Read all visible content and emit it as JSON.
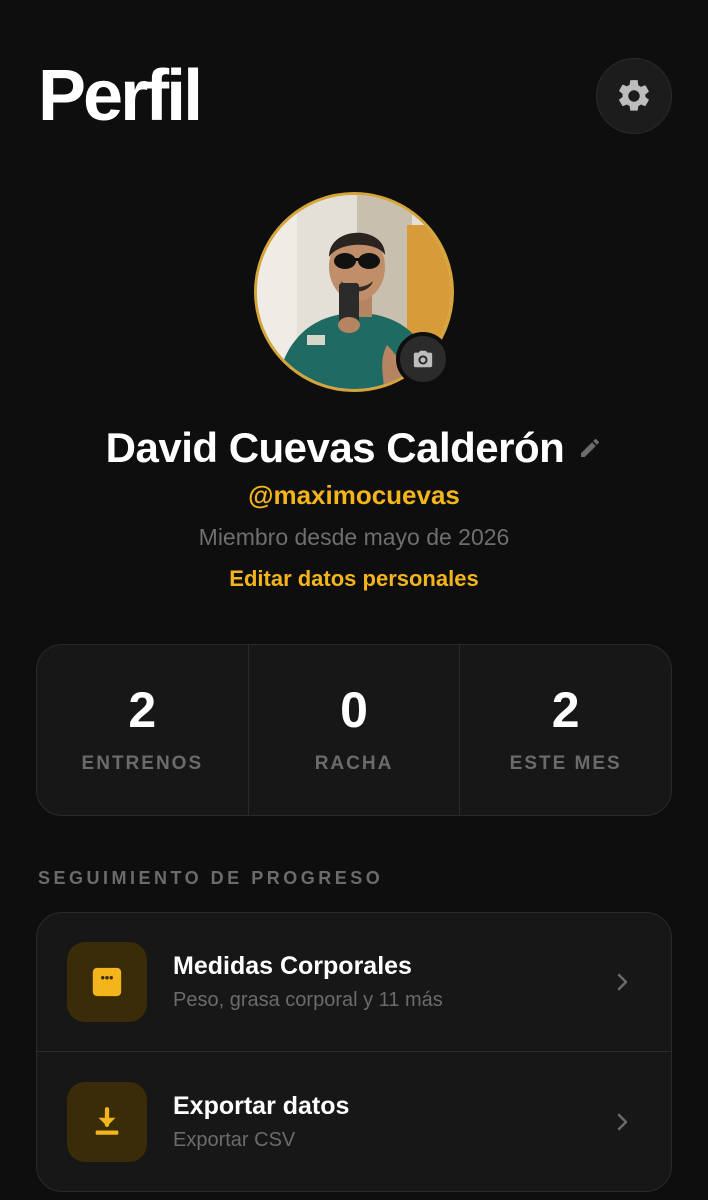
{
  "header": {
    "title": "Perfil"
  },
  "profile": {
    "name": "David Cuevas Calderón",
    "username": "@maximocuevas",
    "member_since": "Miembro desde mayo de 2026",
    "edit_link": "Editar datos personales"
  },
  "stats": [
    {
      "value": "2",
      "label": "ENTRENOS"
    },
    {
      "value": "0",
      "label": "RACHA"
    },
    {
      "value": "2",
      "label": "ESTE MES"
    }
  ],
  "progress_section": {
    "title": "SEGUIMIENTO DE PROGRESO",
    "items": [
      {
        "title": "Medidas Corporales",
        "subtitle": "Peso, grasa corporal y 11 más",
        "icon": "scale-icon"
      },
      {
        "title": "Exportar datos",
        "subtitle": "Exportar CSV",
        "icon": "download-icon"
      }
    ]
  },
  "colors": {
    "accent": "#f3b51b",
    "background": "#0e0e0e",
    "card": "#171717",
    "muted_text": "#6b6b6b"
  }
}
